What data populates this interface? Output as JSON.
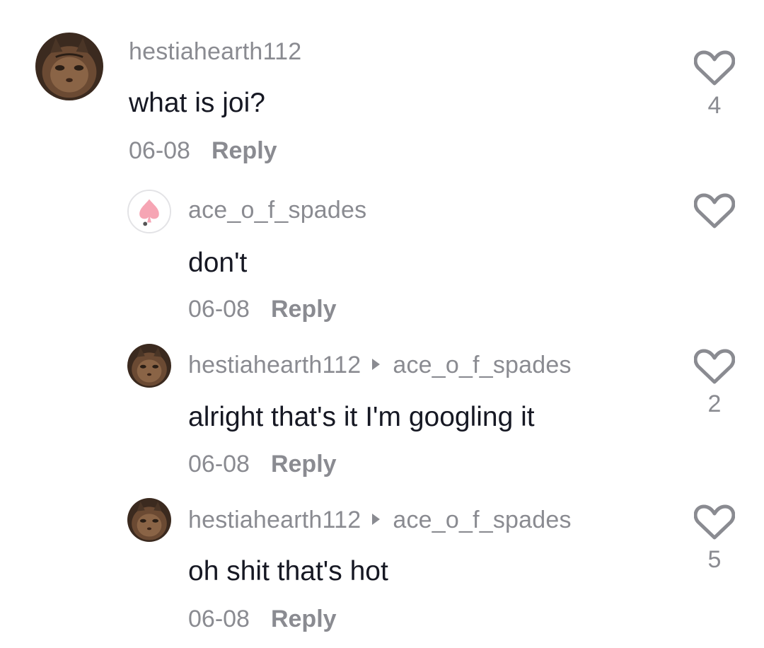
{
  "comments": [
    {
      "username": "hestiahearth112",
      "reply_to": "",
      "text": "what is joi?",
      "date": "06-08",
      "reply_label": "Reply",
      "likes": "4",
      "avatar": "cat-avatar"
    },
    {
      "username": "ace_o_f_spades",
      "reply_to": "",
      "text": "don't",
      "date": "06-08",
      "reply_label": "Reply",
      "likes": "",
      "avatar": "spade-avatar"
    },
    {
      "username": "hestiahearth112",
      "reply_to": "ace_o_f_spades",
      "text": "alright that's it I'm googling it",
      "date": "06-08",
      "reply_label": "Reply",
      "likes": "2",
      "avatar": "cat-avatar"
    },
    {
      "username": "hestiahearth112",
      "reply_to": "ace_o_f_spades",
      "text": "oh shit that's hot",
      "date": "06-08",
      "reply_label": "Reply",
      "likes": "5",
      "avatar": "cat-avatar"
    }
  ],
  "colors": {
    "username": "#8a8b91",
    "text": "#161823",
    "icon": "#8a8b91",
    "spade": "#f6a5b4"
  }
}
